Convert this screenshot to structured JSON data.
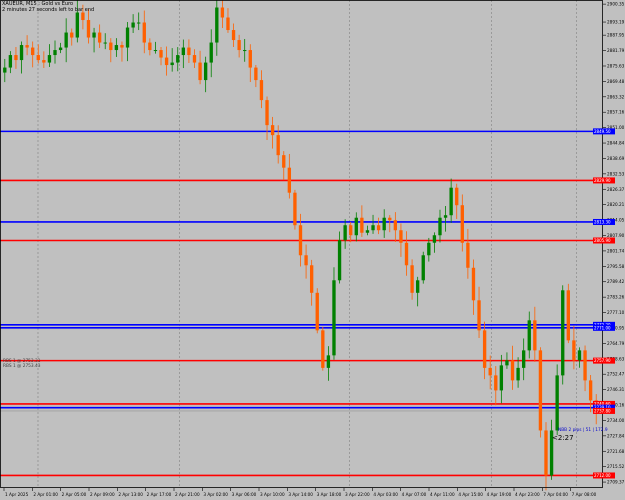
{
  "chart_header": {
    "symbol_line": "XAUEUR, M15 : Gold vs Euro",
    "timer_line": "2 minutes 27 seconds left to bar end"
  },
  "chart_data": {
    "type": "candlestick",
    "symbol": "XAUEUR",
    "timeframe": "M15",
    "ylim": [
      2707,
      2902
    ],
    "y_ticks": [
      2900.35,
      2893.19,
      2887.95,
      2881.79,
      2875.63,
      2869.48,
      2863.32,
      2857.16,
      2851.0,
      2844.84,
      2838.69,
      2832.53,
      2826.37,
      2820.21,
      2814.05,
      2807.9,
      2801.74,
      2795.58,
      2789.42,
      2783.26,
      2777.1,
      2770.95,
      2764.79,
      2758.63,
      2752.47,
      2746.31,
      2740.16,
      2734.0,
      2727.84,
      2721.68,
      2715.52,
      2709.37
    ],
    "x_ticks": [
      "1 Apr 2025",
      "2 Apr 01:00",
      "2 Apr 05:00",
      "2 Apr 09:00",
      "2 Apr 13:00",
      "2 Apr 17:00",
      "2 Apr 21:00",
      "3 Apr 02:00",
      "3 Apr 06:00",
      "3 Apr 10:00",
      "3 Apr 14:00",
      "3 Apr 18:00",
      "3 Apr 22:00",
      "4 Apr 03:00",
      "4 Apr 07:00",
      "4 Apr 11:00",
      "4 Apr 15:00",
      "4 Apr 19:00",
      "4 Apr 23:00",
      "7 Apr 04:00",
      "7 Apr 08:00"
    ],
    "separator_ticks": [
      1,
      6,
      12,
      17,
      20
    ],
    "close_series": [
      2875,
      2880,
      2878,
      2884,
      2883,
      2880,
      2878,
      2877,
      2880,
      2882,
      2883,
      2889,
      2887,
      2897,
      2894,
      2887,
      2889,
      2885,
      2885,
      2882,
      2884,
      2883,
      2891,
      2893,
      2893,
      2885,
      2882,
      2882,
      2879,
      2876,
      2877,
      2880,
      2883,
      2880,
      2877,
      2870,
      2877,
      2885,
      2899,
      2895,
      2890,
      2886,
      2882,
      2882,
      2875,
      2870,
      2862,
      2852,
      2848,
      2840,
      2835,
      2825,
      2812,
      2800,
      2796,
      2785,
      2770,
      2755,
      2760,
      2790,
      2806,
      2812,
      2808,
      2815,
      2809,
      2810,
      2812,
      2810,
      2815,
      2814,
      2810,
      2805,
      2796,
      2785,
      2790,
      2800,
      2805,
      2808,
      2815,
      2816,
      2827,
      2820,
      2805,
      2795,
      2782,
      2770,
      2755,
      2752,
      2746,
      2756,
      2758,
      2750,
      2755,
      2762,
      2774,
      2762,
      2730,
      2712,
      2730,
      2752,
      2786,
      2766,
      2758,
      2762,
      2750,
      2742,
      2738
    ],
    "current_price": 2737.8,
    "horizontal_levels": [
      {
        "color": "blue",
        "price": 2849.5
      },
      {
        "color": "red",
        "price": 2829.9
      },
      {
        "color": "blue",
        "price": 2813.3
      },
      {
        "color": "red",
        "price": 2805.9
      },
      {
        "color": "blue",
        "price": 2772.2
      },
      {
        "color": "blue",
        "price": 2771.0
      },
      {
        "color": "red",
        "price": 2757.9
      },
      {
        "color": "red",
        "price": 2740.6
      },
      {
        "color": "blue",
        "price": 2739.1
      },
      {
        "color": "red",
        "price": 2712.0
      }
    ],
    "colors": {
      "background": "#c0c0c0",
      "up_candle": "#008000",
      "down_candle": "#ff6000",
      "blue_level": "#0000ff",
      "red_level": "#ff0000",
      "price_tag": "#ff0000",
      "grid": "#808080"
    }
  },
  "overlays": {
    "info_line_1": "RBS 1 @ 2753.31",
    "info_line_2": "RBS 1 @ 2753.43",
    "trade_note": "NBB 2 pips | 51 | 172.9",
    "countdown": "<2:27"
  }
}
